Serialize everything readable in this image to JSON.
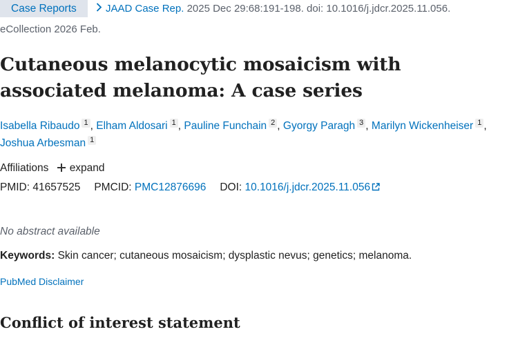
{
  "header": {
    "article_type": "Case Reports",
    "journal": "JAAD Case Rep.",
    "citation": "2025 Dec 29:68:191-198. doi: 10.1016/j.jdcr.2025.11.056.",
    "ecollection": "eCollection 2026 Feb."
  },
  "title": "Cutaneous melanocytic mosaicism with associated melanoma: A case series",
  "authors": [
    {
      "name": "Isabella Ribaudo",
      "aff": "1"
    },
    {
      "name": "Elham Aldosari",
      "aff": "1"
    },
    {
      "name": "Pauline Funchain",
      "aff": "2"
    },
    {
      "name": "Gyorgy Paragh",
      "aff": "3"
    },
    {
      "name": "Marilyn Wickenheiser",
      "aff": "1"
    },
    {
      "name": "Joshua Arbesman",
      "aff": "1"
    }
  ],
  "affiliations": {
    "label": "Affiliations",
    "expand_label": "expand"
  },
  "ids": {
    "pmid_label": "PMID:",
    "pmid": "41657525",
    "pmcid_label": "PMCID:",
    "pmcid": "PMC12876696",
    "doi_label": "DOI:",
    "doi": "10.1016/j.jdcr.2025.11.056"
  },
  "abstract": {
    "no_abstract": "No abstract available"
  },
  "keywords": {
    "label": "Keywords:",
    "text": "Skin cancer; cutaneous mosaicism; dysplastic nevus; genetics; melanoma."
  },
  "disclaimer": "PubMed Disclaimer",
  "sections": {
    "coi_heading": "Conflict of interest statement"
  },
  "colors": {
    "link": "#0071bc",
    "tag_bg": "#dfe4ec",
    "text": "#212121",
    "muted": "#5b616b"
  }
}
